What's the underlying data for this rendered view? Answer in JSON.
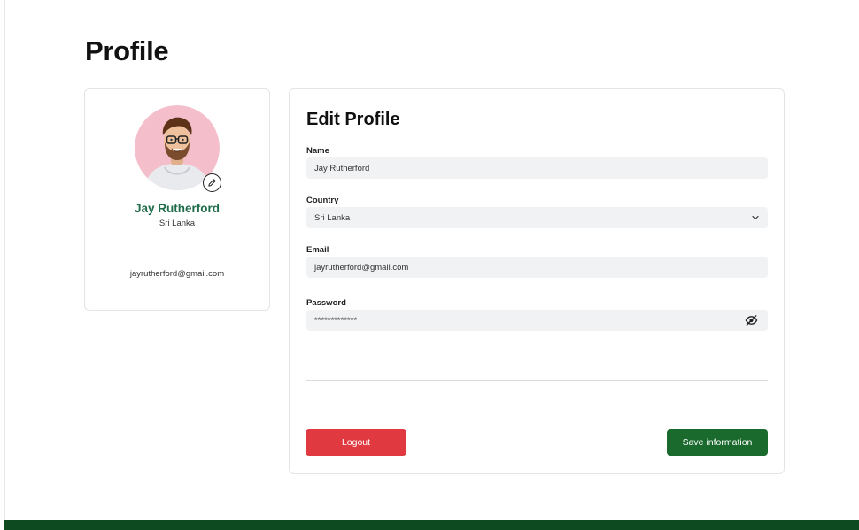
{
  "page": {
    "title": "Profile"
  },
  "profile_card": {
    "name": "Jay Rutherford",
    "country": "Sri Lanka",
    "email": "jayrutherford@gmail.com",
    "avatar_icon": "user-avatar",
    "edit_icon": "pencil-icon"
  },
  "edit_profile": {
    "title": "Edit Profile",
    "name": {
      "label": "Name",
      "value": "Jay Rutherford"
    },
    "country": {
      "label": "Country",
      "value": "Sri Lanka",
      "icon": "chevron-down-icon"
    },
    "email": {
      "label": "Email",
      "value": "jayrutherford@gmail.com"
    },
    "password": {
      "label": "Password",
      "value": "*************",
      "icon": "eye-off-icon"
    },
    "logout_label": "Logout",
    "save_label": "Save information"
  },
  "colors": {
    "name_accent": "#1f6b4a",
    "logout_button": "#e0393f",
    "save_button": "#1a6a2d",
    "footer": "#0e4a1f",
    "field_bg": "#f1f2f4",
    "avatar_bg": "#f4bfcb"
  }
}
